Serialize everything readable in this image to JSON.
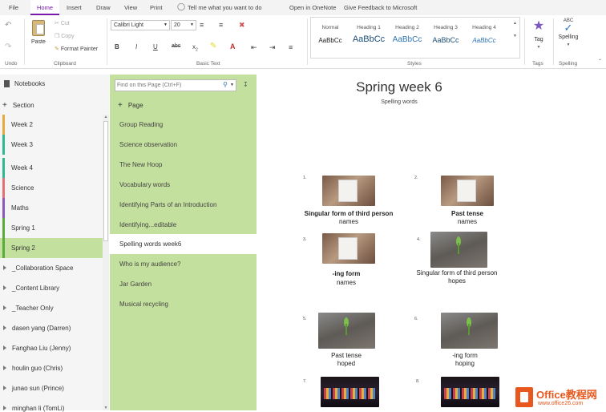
{
  "tabs": [
    "File",
    "Home",
    "Insert",
    "Draw",
    "View",
    "Print"
  ],
  "tell_me": "Tell me what you want to do",
  "open_in_onenote": "Open in OneNote",
  "give_feedback": "Give Feedback to Microsoft",
  "ribbon": {
    "undo_label": "Undo",
    "paste": "Paste",
    "cut": "Cut",
    "copy": "Copy",
    "format_painter": "Format Painter",
    "clipboard_label": "Clipboard",
    "font_name": "Calibri Light",
    "font_size": "20",
    "basic_text_label": "Basic Text",
    "styles": [
      {
        "name": "Normal",
        "sample": "AaBbCc"
      },
      {
        "name": "Heading 1",
        "sample": "AaBbCc"
      },
      {
        "name": "Heading 2",
        "sample": "AaBbCc"
      },
      {
        "name": "Heading 3",
        "sample": "AaBbCc"
      },
      {
        "name": "Heading 4",
        "sample": "AaBbCc"
      }
    ],
    "styles_label": "Styles",
    "tag": "Tag",
    "tags_label": "Tags",
    "spelling": "Spelling",
    "spelling_group": "Spelling",
    "abc": "ABC"
  },
  "notebooks": {
    "header": "Notebooks",
    "add_section": "Section",
    "sections": [
      {
        "label": "Week 2",
        "color": "#e6a840"
      },
      {
        "label": "Week 3",
        "color": "#2fb88f"
      },
      {
        "label": "Week 4",
        "color": "#2fb88f"
      },
      {
        "label": "Science",
        "color": "#e37373"
      },
      {
        "label": "Maths",
        "color": "#8a5bb8"
      },
      {
        "label": "Spring 1",
        "color": "#5aaa3c"
      },
      {
        "label": "Spring 2",
        "color": "#5aaa3c"
      }
    ],
    "groups": [
      "_Collaboration Space",
      "_Content Library",
      "_Teacher Only",
      "dasen yang (Darren)",
      "Fanghao Liu (Jenny)",
      "houlin guo (Chris)",
      "junao sun (Prince)",
      "minghan li (TomLi)"
    ]
  },
  "pages": {
    "search_placeholder": "Find on this Page (Ctrl+F)",
    "add_page": "Page",
    "items": [
      "Group Reading",
      "Science observation",
      "The New Hoop",
      "Vocabulary words",
      "Identifying Parts of an Introduction",
      "Identifying...editable",
      "Spelling words week6",
      "Who is my audience?",
      "Jar Garden",
      "Musical recycling"
    ]
  },
  "doc": {
    "title": "Spring week 6",
    "subtitle": "Spelling words",
    "items": [
      {
        "num": "1.",
        "line1": "Singular form of third person",
        "line2": "names",
        "bold": true
      },
      {
        "num": "2.",
        "line1": "Past tense",
        "line2": "names",
        "bold": true
      },
      {
        "num": "3.",
        "line1": "-ing form",
        "line2": "names",
        "bold": true
      },
      {
        "num": "4.",
        "line1": "Singular form of third person",
        "line2": "hopes",
        "bold": false
      },
      {
        "num": "5.",
        "line1": "Past tense",
        "line2": "hoped",
        "bold": false
      },
      {
        "num": "6.",
        "line1": "-ing form",
        "line2": "hoping",
        "bold": false
      },
      {
        "num": "7.",
        "line1": "",
        "line2": "",
        "bold": false
      },
      {
        "num": "8.",
        "line1": "",
        "line2": "",
        "bold": false
      }
    ]
  },
  "watermark": {
    "brand": "Office教程网",
    "url": "www.office26.com"
  }
}
